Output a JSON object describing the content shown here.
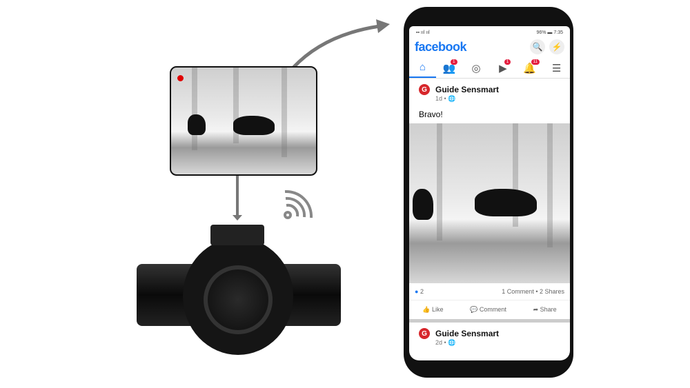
{
  "status_bar": {
    "battery": "96%",
    "time": "7:35"
  },
  "header": {
    "logo": "facebook",
    "search_icon": "search-icon",
    "messenger_icon": "messenger-icon"
  },
  "tabs": [
    {
      "name": "home",
      "active": true
    },
    {
      "name": "friends",
      "badge": "1"
    },
    {
      "name": "groups"
    },
    {
      "name": "watch",
      "badge": "1"
    },
    {
      "name": "notifications",
      "badge": "11"
    },
    {
      "name": "menu"
    }
  ],
  "post": {
    "author": "Guide Sensmart",
    "time": "1d",
    "text": "Bravo!",
    "likes": "2",
    "stats": "1 Comment • 2 Shares",
    "actions": {
      "like": "Like",
      "comment": "Comment",
      "share": "Share"
    }
  },
  "next_post": {
    "author": "Guide Sensmart",
    "time": "2d"
  },
  "colors": {
    "facebook_blue": "#1877f2",
    "badge_red": "#e41e3f",
    "record_dot": "#e00000"
  }
}
